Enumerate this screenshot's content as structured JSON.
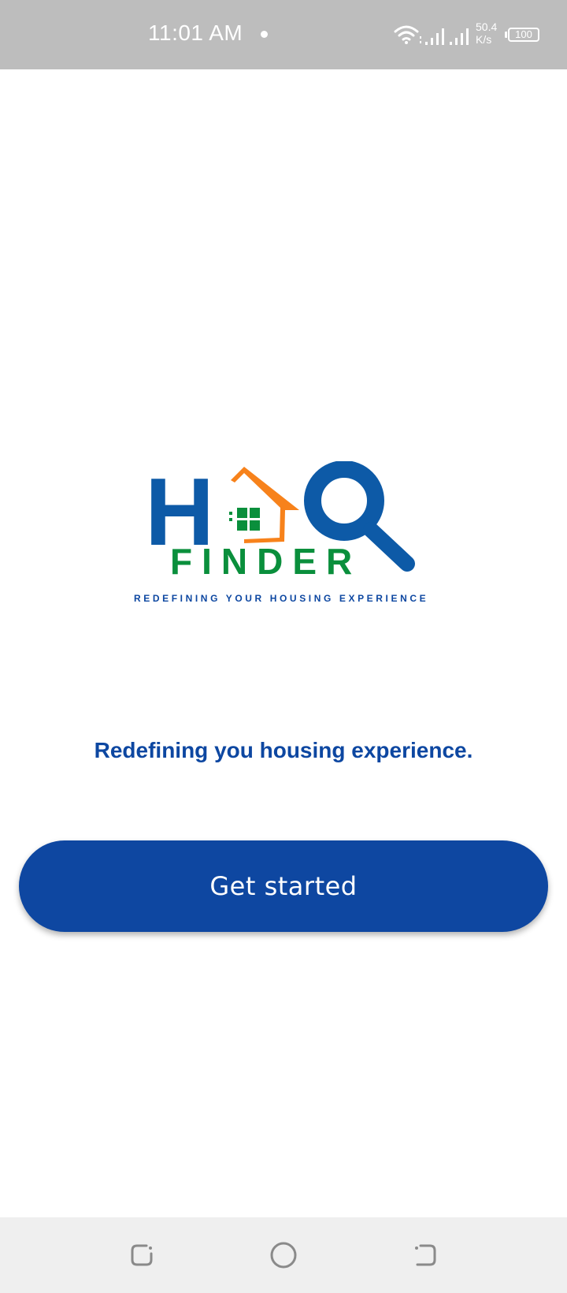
{
  "status_bar": {
    "time": "11:01 AM",
    "net_speed_value": "50.4",
    "net_speed_unit": "K/s",
    "battery": "100",
    "icons": [
      "wifi-icon",
      "signal-icon",
      "signal-icon",
      "battery-icon"
    ]
  },
  "logo": {
    "letter_h": "H",
    "word": "FINDER",
    "slogan": "REDEFINING YOUR HOUSING EXPERIENCE",
    "colors": {
      "blue": "#0d5aa7",
      "orange": "#f7821b",
      "green": "#0a8f3c",
      "navy": "#0d47a1"
    }
  },
  "main": {
    "tagline": "Redefining you housing experience.",
    "get_started_label": "Get started"
  },
  "nav_bar": {
    "buttons": [
      "recents-icon",
      "home-icon",
      "back-icon"
    ]
  },
  "colors": {
    "primary": "#0e47a1",
    "status_bar_bg": "#bdbdbd",
    "nav_bar_bg": "#efefef"
  }
}
